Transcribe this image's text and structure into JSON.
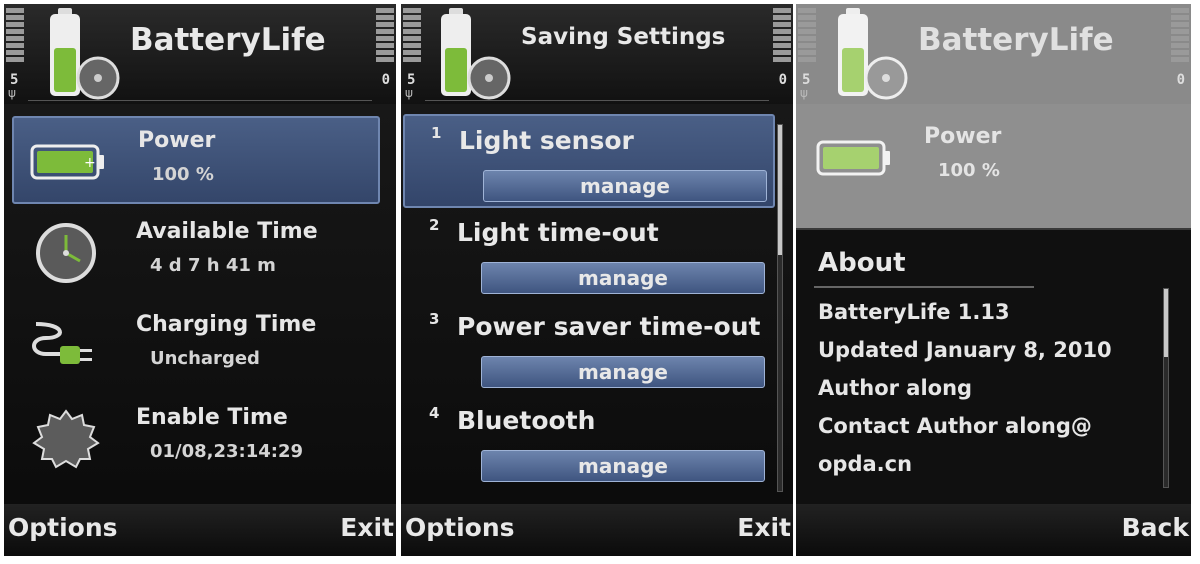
{
  "screen1": {
    "title": "BatteryLife",
    "status_left": "5",
    "status_right": "0",
    "items": [
      {
        "label": "Power",
        "value": "100 %"
      },
      {
        "label": "Available Time",
        "value": "4 d 7 h 41 m"
      },
      {
        "label": "Charging Time",
        "value": "Uncharged"
      },
      {
        "label": "Enable Time",
        "value": "01/08,23:14:29"
      }
    ],
    "softkey_left": "Options",
    "softkey_right": "Exit"
  },
  "screen2": {
    "title": "Saving Settings",
    "status_left": "5",
    "status_right": "0",
    "settings": [
      {
        "num": "1",
        "label": "Light sensor",
        "button": "manage"
      },
      {
        "num": "2",
        "label": "Light time-out",
        "button": "manage"
      },
      {
        "num": "3",
        "label": "Power saver time-out",
        "button": "manage"
      },
      {
        "num": "4",
        "label": "Bluetooth",
        "button": "manage"
      }
    ],
    "softkey_left": "Options",
    "softkey_right": "Exit"
  },
  "screen3": {
    "title": "BatteryLife",
    "status_left": "5",
    "status_right": "0",
    "bg_item": {
      "label": "Power",
      "value": "100 %"
    },
    "dialog": {
      "title": "About",
      "lines": [
        "BatteryLife 1.13",
        "Updated January 8, 2010",
        "Author along",
        "Contact Author  along@",
        "opda.cn"
      ]
    },
    "softkey_right": "Back"
  },
  "colors": {
    "accent_green": "#7dbb3a",
    "highlight_blue": "#4a5f86",
    "button_blue": "#5a71a0"
  }
}
